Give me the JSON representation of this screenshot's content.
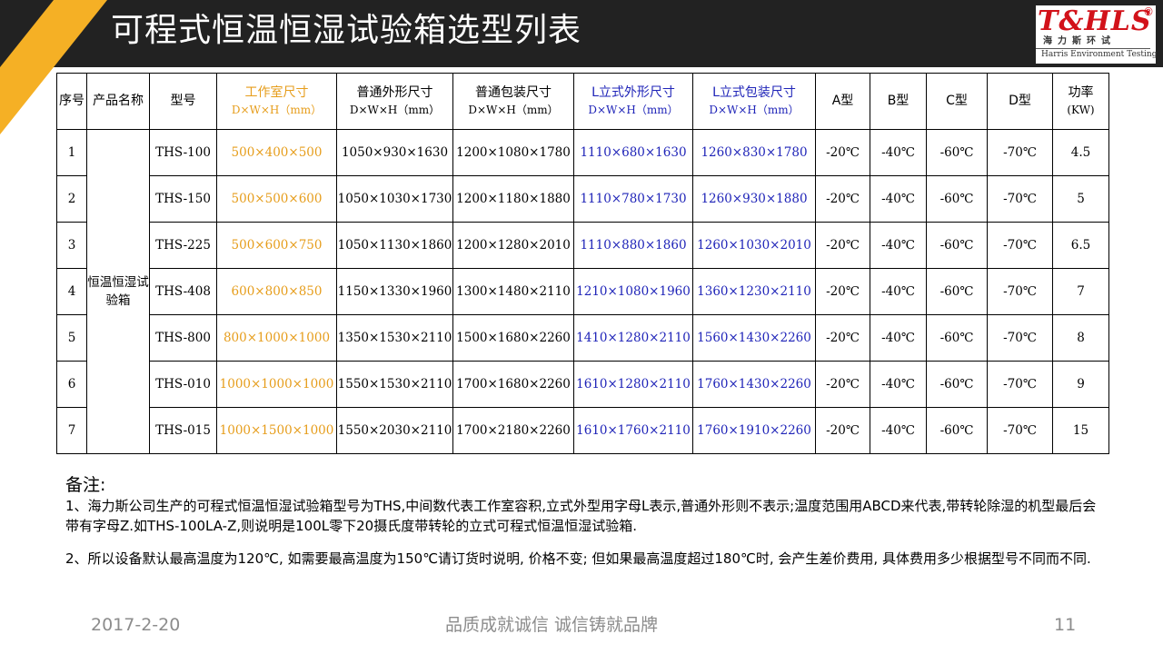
{
  "title": "可程式恒温恒湿试验箱选型列表",
  "logo": {
    "mark": "T&HLS",
    "registered": "®",
    "cn": "海力斯环试",
    "en": "Harris Environment Testing"
  },
  "table": {
    "headers": {
      "seq": "序号",
      "product": "产品名称",
      "model": "型号",
      "chamber": "工作室尺寸",
      "chamber_sub": "D×W×H（mm）",
      "ext": "普通外形尺寸",
      "ext_sub": "D×W×H（mm）",
      "pack": "普通包装尺寸",
      "pack_sub": "D×W×H（mm）",
      "l_ext": "L立式外形尺寸",
      "l_ext_sub": "D×W×H（mm）",
      "l_pack": "L立式包装尺寸",
      "l_pack_sub": "D×W×H（mm）",
      "a": "A型",
      "b": "B型",
      "c": "C型",
      "d": "D型",
      "power": "功率",
      "power_sub": "(KW)"
    },
    "product_name": "恒温恒湿试验箱",
    "rows": [
      {
        "seq": "1",
        "model": "THS-100",
        "chamber": "500×400×500",
        "ext": "1050×930×1630",
        "pack": "1200×1080×1780",
        "l_ext": "1110×680×1630",
        "l_pack": "1260×830×1780",
        "a": "-20℃",
        "b": "-40℃",
        "c": "-60℃",
        "d": "-70℃",
        "power": "4.5"
      },
      {
        "seq": "2",
        "model": "THS-150",
        "chamber": "500×500×600",
        "ext": "1050×1030×1730",
        "pack": "1200×1180×1880",
        "l_ext": "1110×780×1730",
        "l_pack": "1260×930×1880",
        "a": "-20℃",
        "b": "-40℃",
        "c": "-60℃",
        "d": "-70℃",
        "power": "5"
      },
      {
        "seq": "3",
        "model": "THS-225",
        "chamber": "500×600×750",
        "ext": "1050×1130×1860",
        "pack": "1200×1280×2010",
        "l_ext": "1110×880×1860",
        "l_pack": "1260×1030×2010",
        "a": "-20℃",
        "b": "-40℃",
        "c": "-60℃",
        "d": "-70℃",
        "power": "6.5"
      },
      {
        "seq": "4",
        "model": "THS-408",
        "chamber": "600×800×850",
        "ext": "1150×1330×1960",
        "pack": "1300×1480×2110",
        "l_ext": "1210×1080×1960",
        "l_pack": "1360×1230×2110",
        "a": "-20℃",
        "b": "-40℃",
        "c": "-60℃",
        "d": "-70℃",
        "power": "7"
      },
      {
        "seq": "5",
        "model": "THS-800",
        "chamber": "800×1000×1000",
        "ext": "1350×1530×2110",
        "pack": "1500×1680×2260",
        "l_ext": "1410×1280×2110",
        "l_pack": "1560×1430×2260",
        "a": "-20℃",
        "b": "-40℃",
        "c": "-60℃",
        "d": "-70℃",
        "power": "8"
      },
      {
        "seq": "6",
        "model": "THS-010",
        "chamber": "1000×1000×1000",
        "ext": "1550×1530×2110",
        "pack": "1700×1680×2260",
        "l_ext": "1610×1280×2110",
        "l_pack": "1760×1430×2260",
        "a": "-20℃",
        "b": "-40℃",
        "c": "-60℃",
        "d": "-70℃",
        "power": "9"
      },
      {
        "seq": "7",
        "model": "THS-015",
        "chamber": "1000×1500×1000",
        "ext": "1550×2030×2110",
        "pack": "1700×2180×2260",
        "l_ext": "1610×1760×2110",
        "l_pack": "1760×1910×2260",
        "a": "-20℃",
        "b": "-40℃",
        "c": "-60℃",
        "d": "-70℃",
        "power": "15"
      }
    ]
  },
  "notes": {
    "title": "备注:",
    "note1": "1、海力斯公司生产的可程式恒温恒湿试验箱型号为THS,中间数代表工作室容积,立式外型用字母L表示,普通外形则不表示;温度范围用ABCD来代表,带转轮除湿的机型最后会带有字母Z.如THS-100LA-Z,则说明是100L零下20摄氏度带转轮的立式可程式恒温恒湿试验箱.",
    "note2": "2、所以设备默认最高温度为120℃, 如需要最高温度为150℃请订货时说明, 价格不变; 但如果最高温度超过180℃时, 会产生差价费用, 具体费用多少根据型号不同而不同."
  },
  "footer": {
    "date": "2017-2-20",
    "slogan": "品质成就诚信  诚信铸就品牌",
    "page": "11"
  },
  "colors": {
    "accent": "#f5b025",
    "title_bar": "#222222",
    "chamber_text": "#e69d1b",
    "l_type_text": "#1f24b8",
    "logo_red": "#d2121a"
  }
}
